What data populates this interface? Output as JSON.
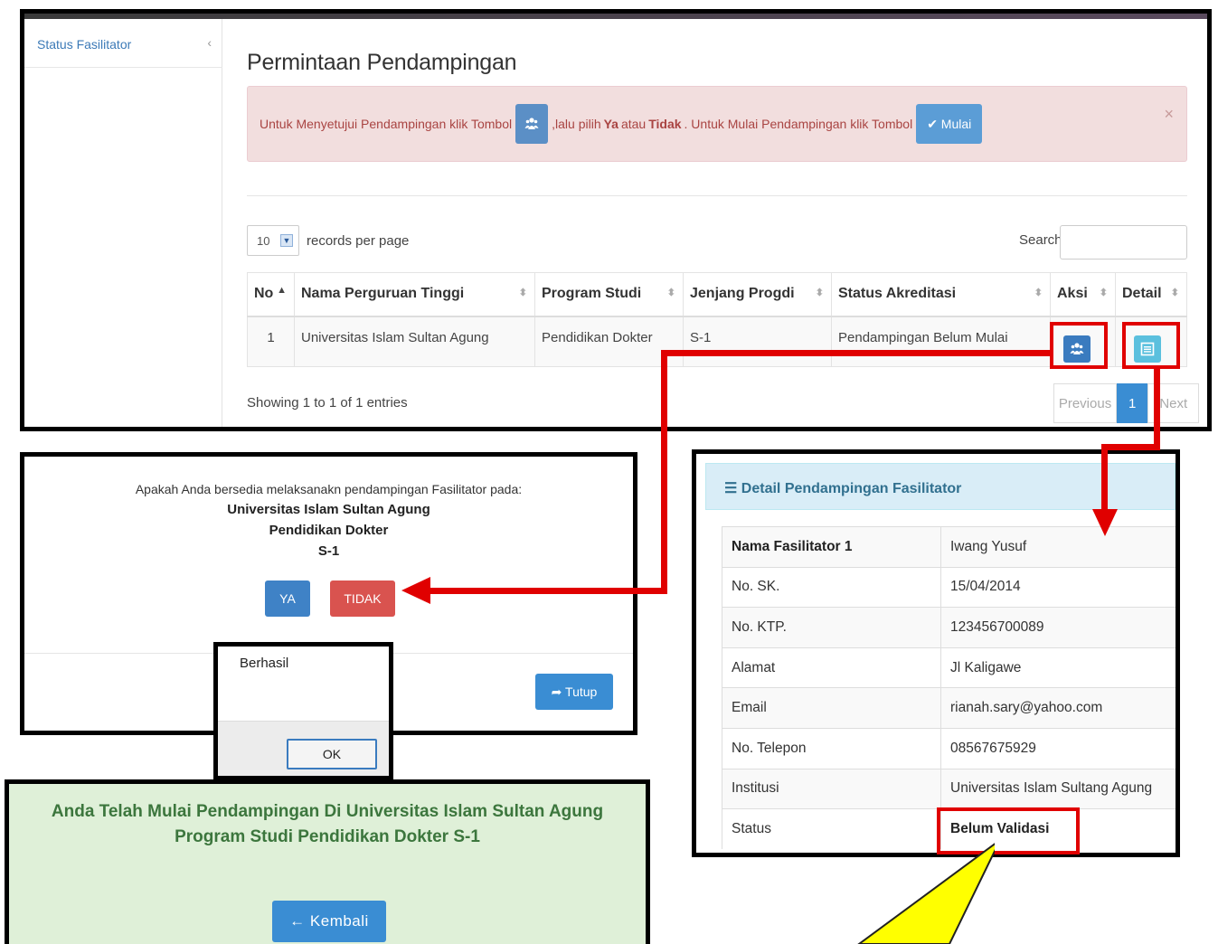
{
  "sidebar": {
    "items": [
      {
        "label": "Status Fasilitator",
        "chevron": "‹"
      }
    ]
  },
  "page": {
    "title": "Permintaan Pendampingan"
  },
  "alert": {
    "text_1": "Untuk Menyetujui Pendampingan klik Tombol",
    "text_2": ",lalu pilih",
    "ya": "Ya",
    "atau": "atau",
    "tidak": "Tidak",
    "text_3": ". Untuk Mulai Pendampingan klik Tombol",
    "mulai_label": "✔ Mulai",
    "close": "×",
    "icon": "users-icon"
  },
  "table_controls": {
    "length_value": "10",
    "length_label": "records per page",
    "search_label": "Search:",
    "search_value": ""
  },
  "table": {
    "columns": [
      "No",
      "Nama Perguruan Tinggi",
      "Program Studi",
      "Jenjang Progdi",
      "Status Akreditasi",
      "Aksi",
      "Detail"
    ],
    "rows": [
      {
        "no": "1",
        "pt": "Universitas Islam Sultan Agung",
        "prodi": "Pendidikan Dokter",
        "jenjang": "S-1",
        "status": "Pendampingan Belum Mulai"
      }
    ],
    "showing": "Showing 1 to 1 of 1 entries",
    "pager": {
      "prev": "Previous",
      "current": "1",
      "next": "Next"
    }
  },
  "confirm": {
    "question": "Apakah Anda bersedia melaksanakn pendampingan Fasilitator pada:",
    "pt": "Universitas Islam Sultan Agung",
    "prodi": "Pendidikan Dokter",
    "jenjang": "S-1",
    "ya_label": "YA",
    "tidak_label": "TIDAK",
    "tutup_label": "➦ Tutup"
  },
  "berhasil": {
    "message": "Berhasil",
    "ok_label": "OK"
  },
  "success": {
    "line_1": "Anda Telah Mulai Pendampingan Di Universitas Islam Sultan Agung",
    "line_2": "Program Studi Pendidikan Dokter S-1",
    "kembali_label": "← Kembali"
  },
  "detail": {
    "title": "Detail Pendampingan Fasilitator",
    "rows": [
      {
        "label": "Nama Fasilitator 1",
        "value": "Iwang Yusuf"
      },
      {
        "label": "No. SK.",
        "value": "15/04/2014"
      },
      {
        "label": "No. KTP.",
        "value": "123456700089"
      },
      {
        "label": "Alamat",
        "value": "Jl Kaligawe"
      },
      {
        "label": "Email",
        "value": "rianah.sary@yahoo.com"
      },
      {
        "label": "No. Telepon",
        "value": "08567675929"
      },
      {
        "label": "Institusi",
        "value": "Universitas Islam Sultang Agung"
      },
      {
        "label": "Status",
        "value": "Belum Validasi"
      }
    ]
  },
  "colors": {
    "highlight": "#e00000",
    "callout": "#ffff00",
    "primary": "#3a8dd3",
    "danger": "#d9534f",
    "info": "#5bc0de",
    "alert_bg": "#f2dede",
    "success_bg": "#dff0d8"
  }
}
